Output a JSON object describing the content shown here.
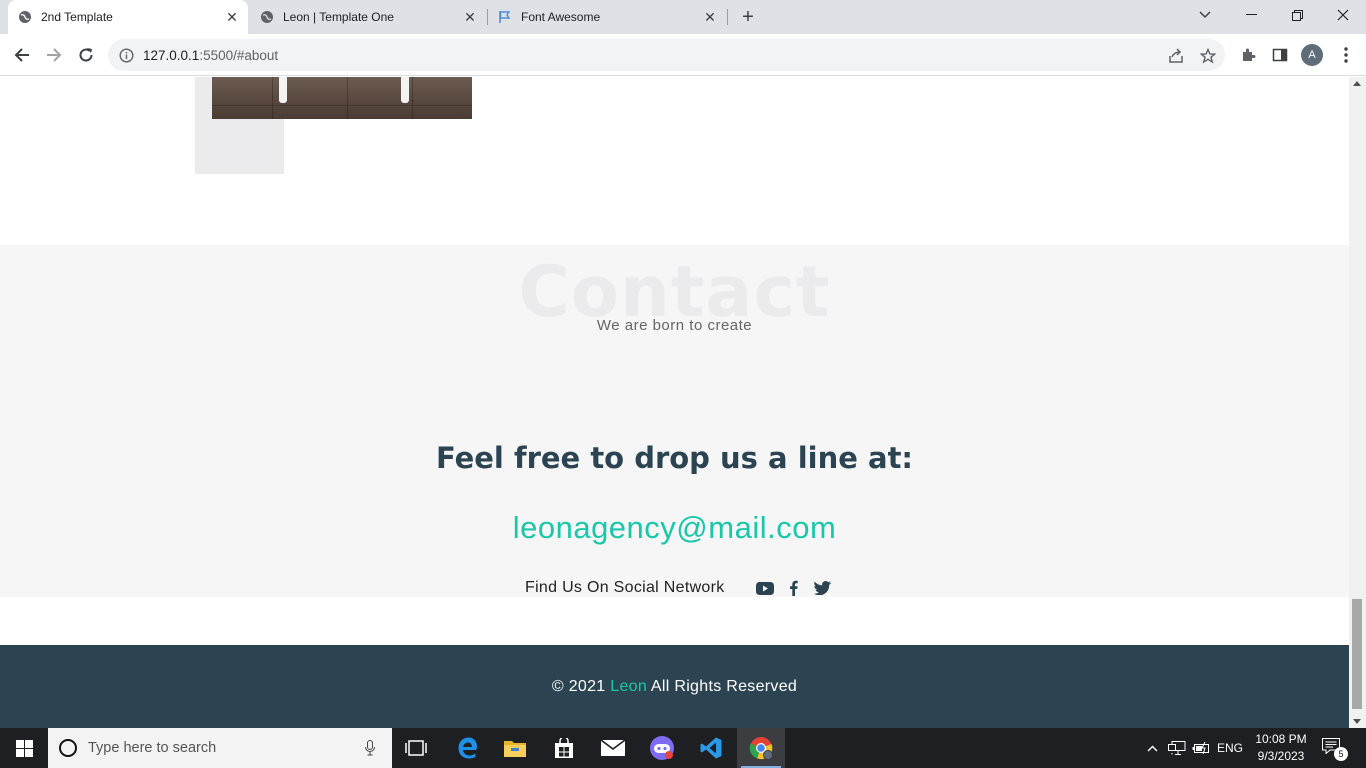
{
  "browser": {
    "tabs": [
      {
        "title": "2nd Template",
        "icon": "globe-icon",
        "active": true
      },
      {
        "title": "Leon | Template One",
        "icon": "globe-icon",
        "active": false
      },
      {
        "title": "Font Awesome",
        "icon": "flag-icon",
        "active": false
      }
    ],
    "url_host": "127.0.0.1",
    "url_rest": ":5500/#about",
    "profile_initial": "A"
  },
  "page": {
    "contact": {
      "big_title": "Contact",
      "subtitle": "We are born to create",
      "heading": "Feel free to drop us a line at:",
      "email": "leonagency@mail.com",
      "social_label": "Find Us On Social Network",
      "social_icons": [
        "youtube-icon",
        "facebook-icon",
        "twitter-icon"
      ]
    },
    "footer": {
      "copyright_prefix": "© 2021",
      "brand": "Leon",
      "rights": "All Rights Reserved"
    },
    "colors": {
      "accent": "#19c8a9",
      "dark": "#2c4452",
      "contact_bg": "#f6f6f6"
    }
  },
  "taskbar": {
    "search_placeholder": "Type here to search",
    "language": "ENG",
    "time": "10:08 PM",
    "date": "9/3/2023",
    "notification_count": "5"
  }
}
